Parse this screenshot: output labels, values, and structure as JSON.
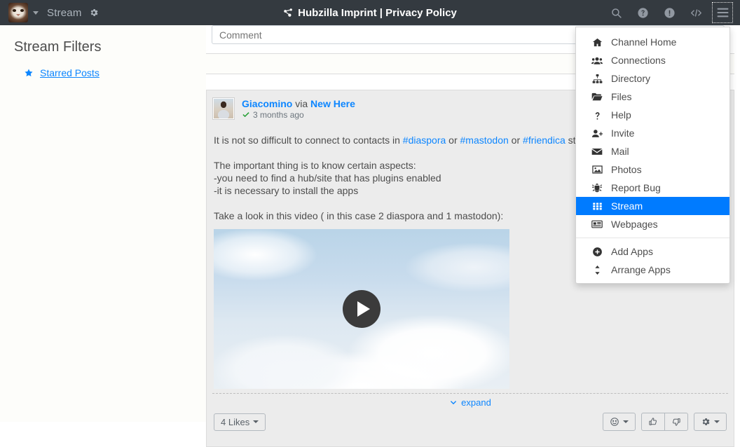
{
  "navbar": {
    "avatar_name": "cat-avatar",
    "channel_caret": "chevron-down-icon",
    "stream_label": "Stream",
    "gear_icon": "gear-icon",
    "title": "Hubzilla Imprint | Privacy Policy",
    "title_icon": "share-nodes-icon",
    "right_icons": [
      {
        "name": "search-icon",
        "label": "Search"
      },
      {
        "name": "help-icon",
        "label": "Help"
      },
      {
        "name": "info-icon",
        "label": "Info"
      },
      {
        "name": "code-icon",
        "label": "Source"
      },
      {
        "name": "hamburger-menu-icon",
        "label": "Apps menu"
      }
    ]
  },
  "sidebar": {
    "title": "Stream Filters",
    "items": [
      {
        "label": "Starred Posts",
        "icon": "star-icon"
      }
    ]
  },
  "comment": {
    "placeholder": "Comment",
    "value": ""
  },
  "post": {
    "author": "Giacomino",
    "via_word": "via",
    "channel": "New Here",
    "verified_icon": "check-icon",
    "timestamp": "3 months ago",
    "paragraphs": [
      {
        "parts": [
          {
            "t": "It is not so difficult to connect to contacts in "
          },
          {
            "t": "#diaspora",
            "link": true
          },
          {
            "t": " or "
          },
          {
            "t": "#mastodon",
            "link": true
          },
          {
            "t": " or "
          },
          {
            "t": "#friendica",
            "link": true
          },
          {
            "t": " st"
          }
        ]
      },
      {
        "parts": [
          {
            "t": "The important thing is to know certain aspects:"
          }
        ]
      },
      {
        "parts": [
          {
            "t": "-you need to find a hub/site that has plugins enabled"
          }
        ]
      },
      {
        "parts": [
          {
            "t": "-it is necessary to install the apps"
          }
        ]
      },
      {
        "parts": [
          {
            "t": "Take a look in this video ( in this case 2 diaspora and 1 mastodon):"
          }
        ]
      }
    ],
    "video": {
      "name": "video-thumbnail",
      "play_icon": "play-icon",
      "alt": "Clouds in a blue sky"
    },
    "expand_label": "expand",
    "expand_icon": "chevron-down-icon",
    "likes_label": "4 Likes",
    "actions": [
      {
        "name": "emoji-button",
        "icon": "smiley-icon",
        "caret": true
      },
      {
        "name": "like-button",
        "icon": "thumbs-up-icon",
        "caret": false
      },
      {
        "name": "dislike-button",
        "icon": "thumbs-down-icon",
        "caret": false
      },
      {
        "name": "settings-button",
        "icon": "gear-icon",
        "caret": true
      }
    ]
  },
  "app_menu": {
    "items": [
      {
        "label": "Channel Home",
        "icon": "home-icon",
        "active": false
      },
      {
        "label": "Connections",
        "icon": "users-icon",
        "active": false
      },
      {
        "label": "Directory",
        "icon": "sitemap-icon",
        "active": false
      },
      {
        "label": "Files",
        "icon": "folder-open-icon",
        "active": false
      },
      {
        "label": "Help",
        "icon": "question-icon",
        "active": false
      },
      {
        "label": "Invite",
        "icon": "user-plus-icon",
        "active": false
      },
      {
        "label": "Mail",
        "icon": "envelope-icon",
        "active": false
      },
      {
        "label": "Photos",
        "icon": "image-icon",
        "active": false
      },
      {
        "label": "Report Bug",
        "icon": "bug-icon",
        "active": false
      },
      {
        "label": "Stream",
        "icon": "grid-icon",
        "active": true
      },
      {
        "label": "Webpages",
        "icon": "newspaper-icon",
        "active": false
      }
    ],
    "footer_items": [
      {
        "label": "Add Apps",
        "icon": "plus-circle-icon"
      },
      {
        "label": "Arrange Apps",
        "icon": "sort-icon"
      }
    ]
  },
  "colors": {
    "navbar_bg": "#343a40",
    "accent_blue": "#007bff",
    "link_blue": "#0d86ff",
    "card_bg": "#ececec",
    "sidebar_bg": "#fdfdfa",
    "verified_green": "#1f9d2f"
  }
}
